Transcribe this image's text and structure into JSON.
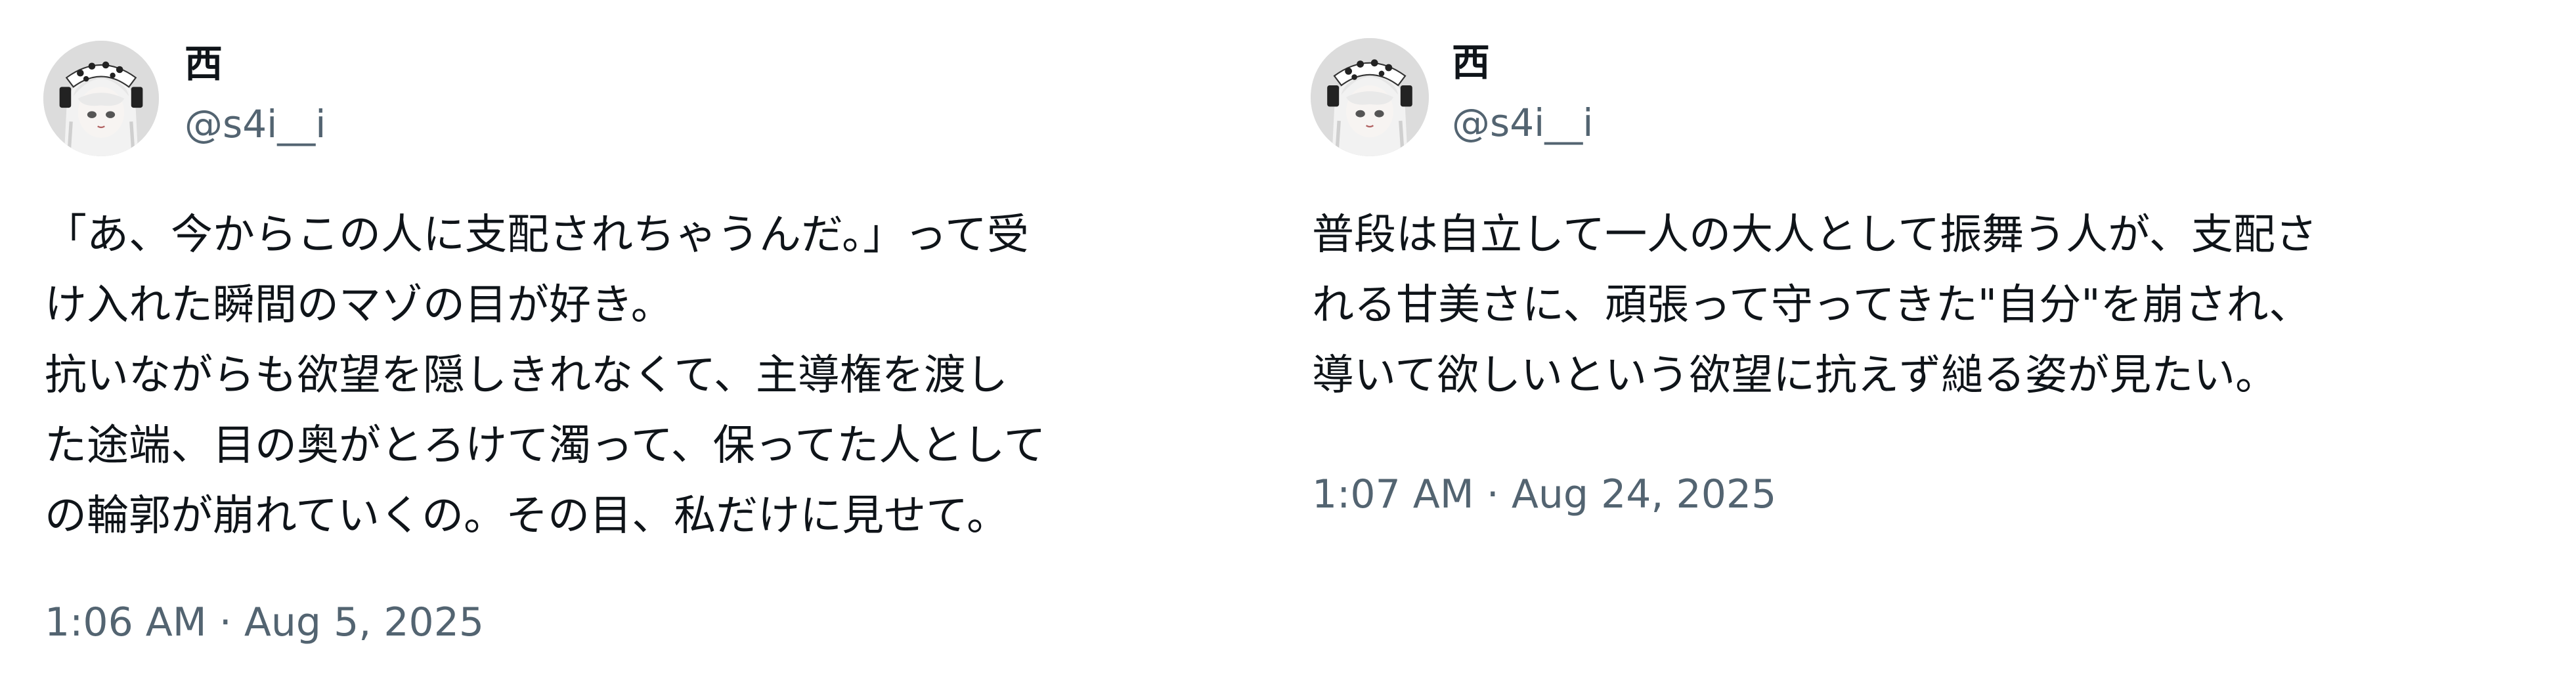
{
  "tweets": [
    {
      "author": {
        "display_name": "西",
        "handle": "@s4i__i",
        "avatar_icon": "profile-avatar-icon"
      },
      "lines": [
        "「あ、今からこの人に支配されちゃうんだ。」って受",
        "け入れた瞬間のマゾの目が好き。",
        "抗いながらも欲望を隠しきれなくて、主導権を渡し",
        "た途端、目の奥がとろけて濁って、保ってた人として",
        "の輪郭が崩れていくの。その目、私だけに見せて。"
      ],
      "timestamp": "1:06 AM · Aug 5, 2025"
    },
    {
      "author": {
        "display_name": "西",
        "handle": "@s4i__i",
        "avatar_icon": "profile-avatar-icon"
      },
      "lines": [
        "普段は自立して一人の大人として振舞う人が、支配さ",
        "れる甘美さに、頑張って守ってきた\"自分\"を崩され、",
        "導いて欲しいという欲望に抗えず縋る姿が見たい。"
      ],
      "timestamp": "1:07 AM · Aug 24, 2025"
    }
  ],
  "colors": {
    "text_primary": "#0f1419",
    "text_secondary": "#536471",
    "background": "#ffffff"
  }
}
